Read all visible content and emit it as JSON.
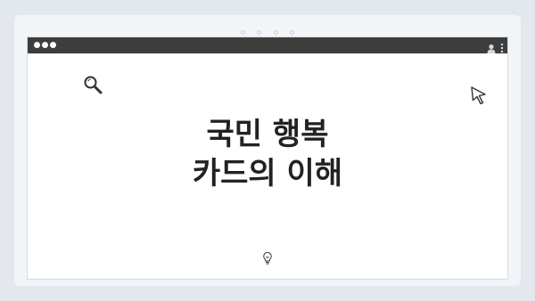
{
  "headline": {
    "line1": "국민 행복",
    "line2": "카드의 이해"
  },
  "pager": {
    "dot_count": 4
  },
  "browser": {
    "window_dots": 3
  },
  "icons": {
    "search": "search-icon",
    "cursor": "cursor-icon",
    "idea": "lightbulb-icon",
    "account": "user-icon",
    "menu": "kebab-menu-icon"
  },
  "colors": {
    "background": "#e3e8ee",
    "card": "#f2f5f8",
    "title_bar": "#3d3d3d",
    "text": "#222222"
  }
}
